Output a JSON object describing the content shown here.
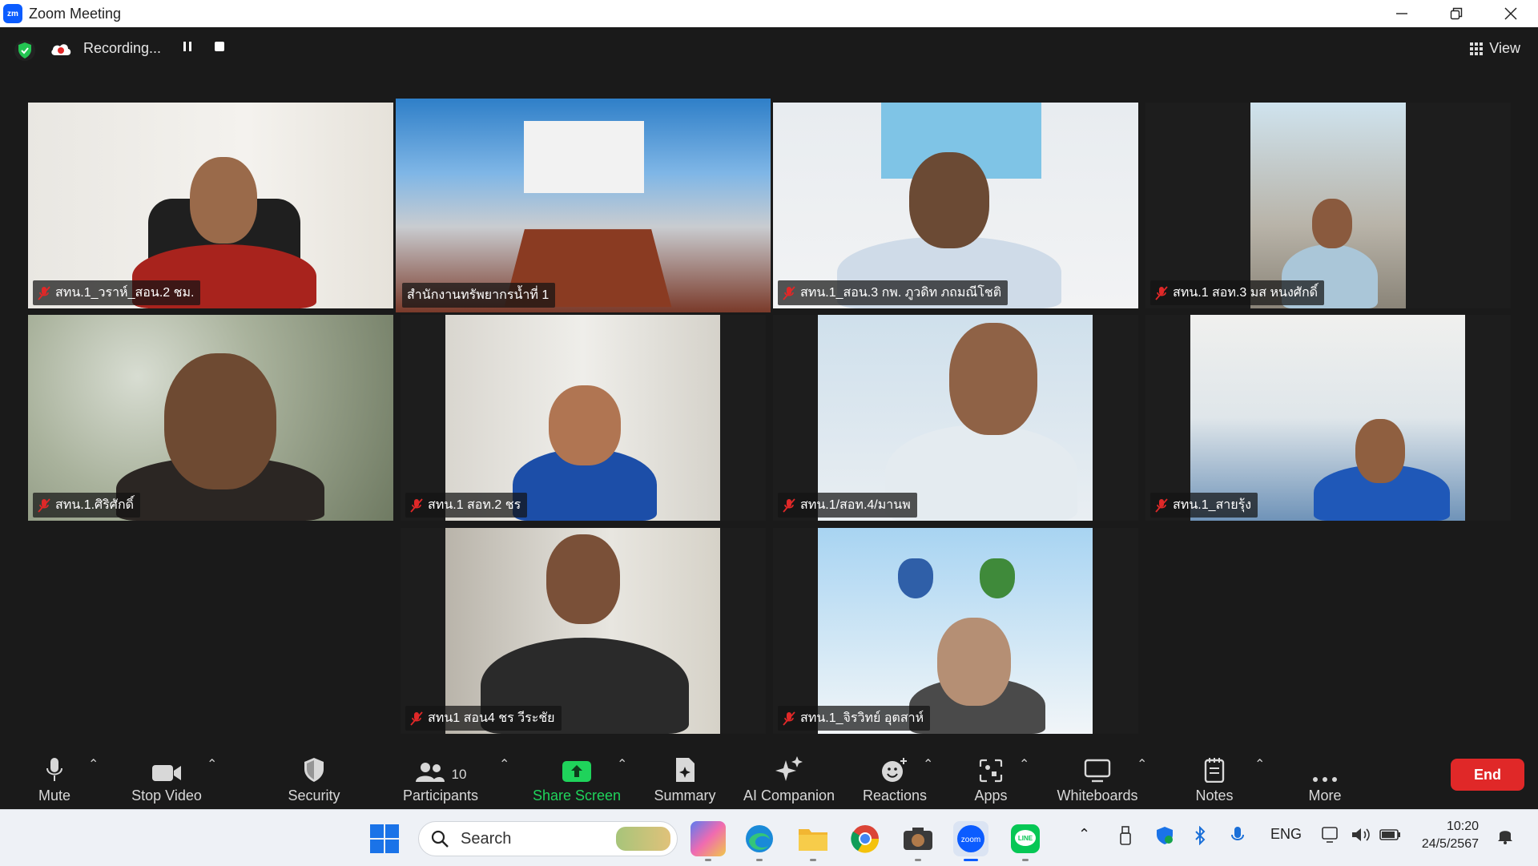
{
  "window": {
    "title": "Zoom Meeting",
    "logo": "zm"
  },
  "topbar": {
    "recording_label": "Recording...",
    "view_label": "View"
  },
  "tiles": [
    {
      "name": "สทน.1_วราห์_สอน.2 ชม.",
      "muted": true
    },
    {
      "name": "สำนักงานทรัพยากรน้ำที่ 1",
      "muted": false,
      "active_speaker": true
    },
    {
      "name": "สทน.1_สอน.3 กพ. ภูวดิท ภถมณีโชติ",
      "muted": true
    },
    {
      "name": "สทน.1 สอท.3 มส หนงศักดิ์",
      "muted": true
    },
    {
      "name": "สทน.1.ศิริศักดิ์",
      "muted": true
    },
    {
      "name": "สทน.1 สอท.2 ชร",
      "muted": true
    },
    {
      "name": "สทน.1/สอท.4/มานพ",
      "muted": true
    },
    {
      "name": "สทน.1_สายรุ้ง",
      "muted": true
    },
    {
      "name": "สทน1 สอน4 ชร วีระชัย",
      "muted": true
    },
    {
      "name": "สทน.1_จิรวิทย์ อุตสาห์",
      "muted": true
    }
  ],
  "toolbar": {
    "mute": "Mute",
    "stop_video": "Stop Video",
    "security": "Security",
    "participants": "Participants",
    "participants_count": "10",
    "share_screen": "Share Screen",
    "summary": "Summary",
    "ai_companion": "AI Companion",
    "reactions": "Reactions",
    "apps": "Apps",
    "whiteboards": "Whiteboards",
    "notes": "Notes",
    "more": "More",
    "end": "End"
  },
  "taskbar": {
    "search_label": "Search",
    "lang": "ENG",
    "time": "10:20",
    "date": "24/5/2567"
  },
  "colors": {
    "active_speaker_border": "#d7e34a",
    "share_screen_green": "#1fd35b",
    "end_red": "#e02828",
    "muted_red": "#e02828"
  }
}
